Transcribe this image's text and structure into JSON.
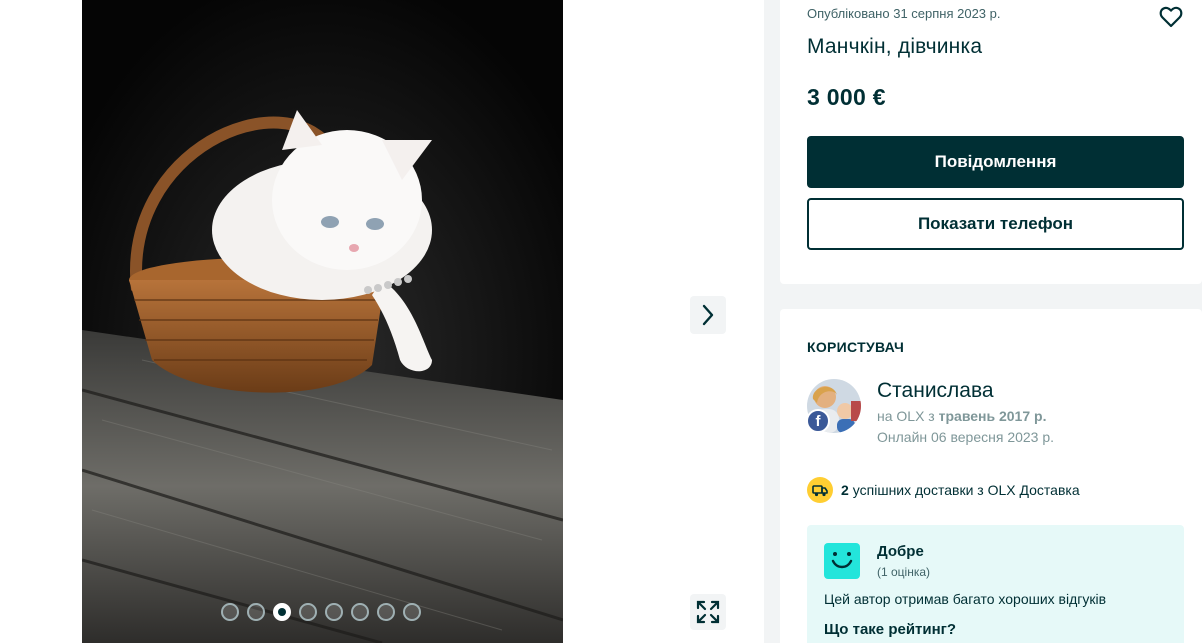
{
  "listing": {
    "published": "Опубліковано 31 серпня 2023 р.",
    "title": "Манчкін, дівчинка",
    "price": "3 000 €",
    "message_button": "Повідомлення",
    "phone_button": "Показати телефон"
  },
  "gallery": {
    "image_count": 8,
    "active_index": 3,
    "next_icon": "chevron-right-icon",
    "expand_icon": "expand-icon"
  },
  "user": {
    "section_title": "КОРИСТУВАЧ",
    "name": "Станислава",
    "since_prefix": "на OLX з",
    "since_date": "травень 2017 р.",
    "online": "Онлайн 06 вересня 2023 р.",
    "deliveries_count": "2",
    "deliveries_text": "успішних доставки з OLX Доставка",
    "rating_label": "Добре",
    "rating_count": "(1 оцінка)",
    "rating_desc": "Цей автор отримав багато хороших відгуків",
    "rating_link": "Що таке рейтинг?"
  },
  "colors": {
    "primary": "#002f34",
    "rating_bg": "#e6f9f8",
    "rating_icon": "#23e5db",
    "delivery_badge": "#ffce32",
    "facebook": "#3b5998"
  }
}
